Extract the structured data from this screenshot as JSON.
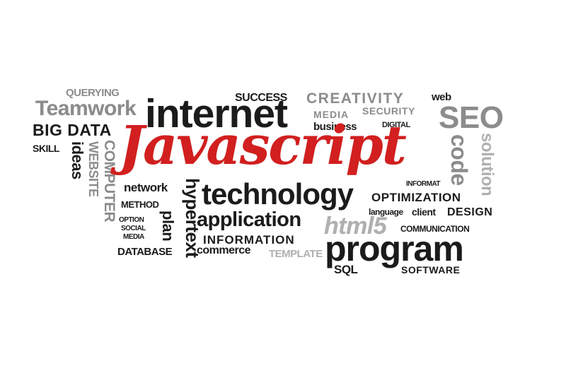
{
  "words": {
    "querying": "QUERYING",
    "teamwork": "Teamwork",
    "big_data": "BIG DATA",
    "skill": "SKILL",
    "ideas": "ideas",
    "computer": "COMPUTER",
    "website": "WEBSITE",
    "internet": "internet",
    "success": "SUCCESS",
    "creativity": "CREATIVITY",
    "web": "web",
    "media": "MEDIA",
    "security": "SECURITY",
    "seo": "SEO",
    "business": "business",
    "digital": "DIGITAL",
    "javascript": "Javascript",
    "code": "code",
    "solution": "solution",
    "informat": "INFORMAT",
    "network": "network",
    "method": "METHOD",
    "hypertext": "hypertext",
    "technology": "technology",
    "optimization": "OPTIMIZATION",
    "language": "language",
    "client": "client",
    "design": "DESIGN",
    "option": "OPTION",
    "social": "SOCIAL",
    "media_small": "MEDIA",
    "plan": "plan",
    "application": "application",
    "html5": "html5",
    "communication": "COMMUNICATION",
    "information": "INFORMATION",
    "database": "DATABASE",
    "commerce": "commerce",
    "template": "TEMPLATE",
    "program": "program",
    "sql": "SQL",
    "software": "SOFTWARE"
  },
  "colors": {
    "dark": "#1b1b1b",
    "gray": "#8c8c8c",
    "light_gray": "#b0b0b0",
    "accent_red": "#d21f1f"
  }
}
